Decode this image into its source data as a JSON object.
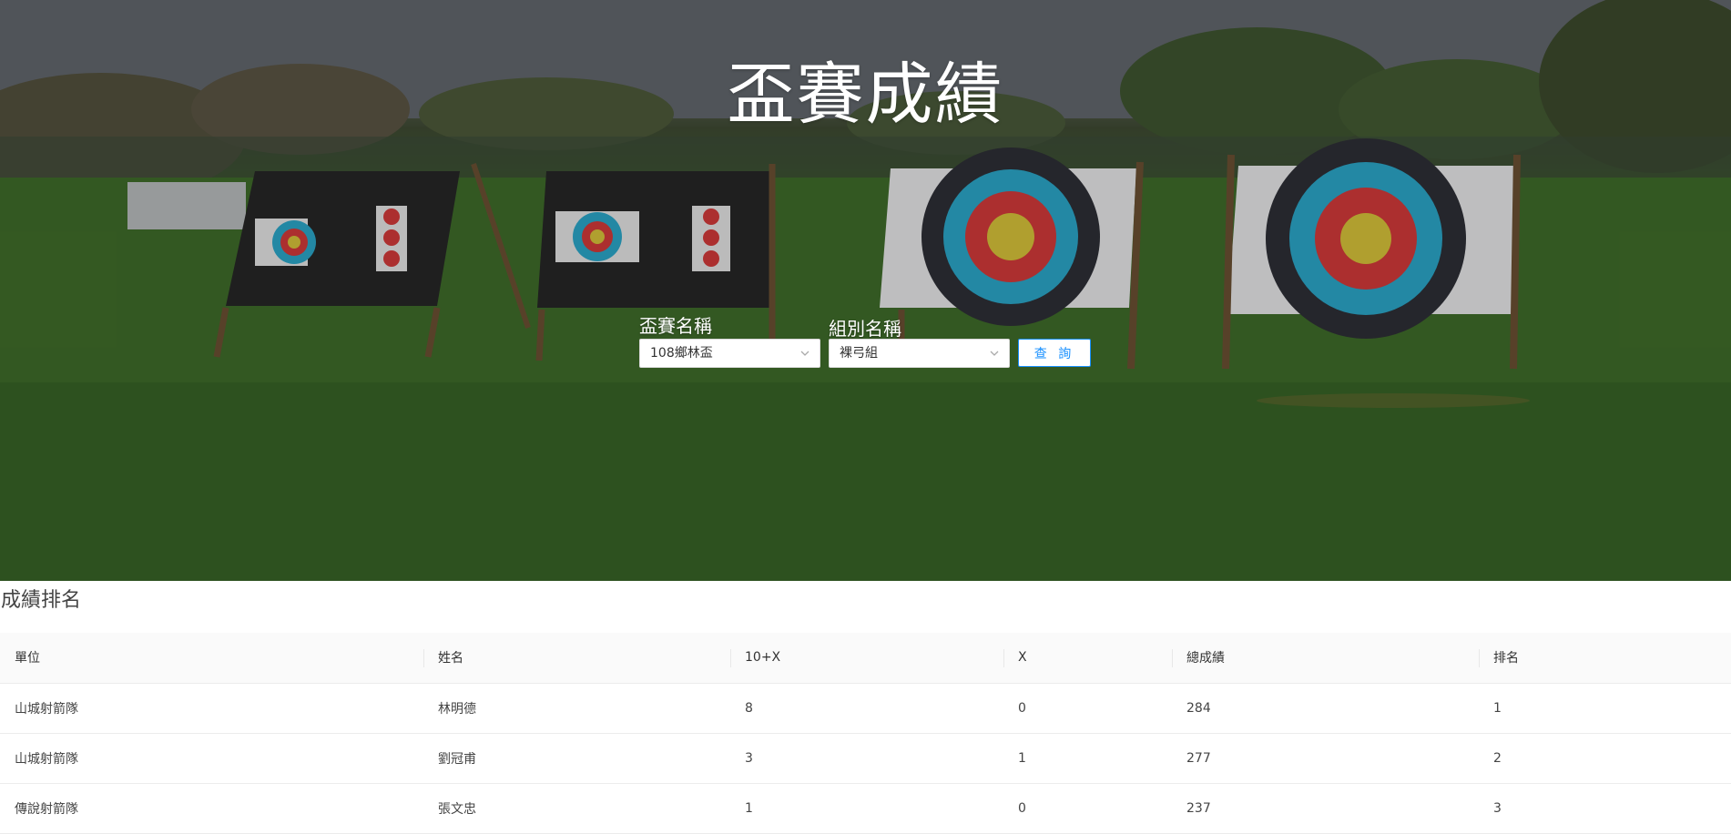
{
  "hero": {
    "title": "盃賽成績"
  },
  "filters": {
    "competition_label": "盃賽名稱",
    "competition_value": "108鄉林盃",
    "group_label": "組別名稱",
    "group_value": "裸弓組",
    "query_label": "查 詢"
  },
  "results": {
    "title": "成績排名",
    "columns": [
      "單位",
      "姓名",
      "10+X",
      "X",
      "總成績",
      "排名"
    ],
    "rows": [
      [
        "山城射箭隊",
        "林明德",
        "8",
        "0",
        "284",
        "1"
      ],
      [
        "山城射箭隊",
        "劉冠甫",
        "3",
        "1",
        "277",
        "2"
      ],
      [
        "傳說射箭隊",
        "張文忠",
        "1",
        "0",
        "237",
        "3"
      ]
    ]
  },
  "colors": {
    "accent": "#1890ff",
    "header_bg": "#fafafa",
    "grass": "#3c6628"
  }
}
